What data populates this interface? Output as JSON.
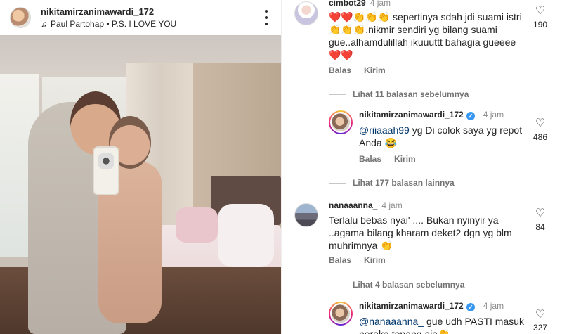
{
  "post": {
    "username": "nikitamirzanimawardi_172",
    "music": "Paul Partohap • P.S. I LOVE YOU"
  },
  "comments": [
    {
      "username": "cimbot29",
      "time": "4 jam",
      "text": "❤️❤️👏👏👏 sepertinya sdah jdi suami istri👏👏👏,nikmir sendiri yg bilang suami gue..alhamdulillah ikuuuttt bahagia gueeee ❤️❤️",
      "likes": "190",
      "reply": "Balas",
      "send": "Kirim"
    },
    {
      "view_replies": "Lihat 11 balasan sebelumnya"
    },
    {
      "username": "nikitamirzanimawardi_172",
      "time": "4 jam",
      "mention": "@riiaaah99",
      "text": " yg Di colok saya yg repot Anda 😂",
      "likes": "486",
      "reply": "Balas",
      "send": "Kirim"
    },
    {
      "view_replies": "Lihat 177 balasan lainnya"
    },
    {
      "username": "nanaaanna_",
      "time": "4 jam",
      "text": "Terlalu bebas nyai' .... Bukan nyinyir ya ..agama bilang kharam deket2 dgn yg blm muhrimnya 👏",
      "likes": "84",
      "reply": "Balas",
      "send": "Kirim"
    },
    {
      "view_replies": "Lihat 4 balasan sebelumnya"
    },
    {
      "username": "nikitamirzanimawardi_172",
      "time": "4 jam",
      "mention": "@nanaaanna_",
      "text": " gue udh PASTI masuk neraka tenang aja👏",
      "likes": "327"
    }
  ],
  "icons": {
    "heart": "♡",
    "music": "♫",
    "verified": "✓"
  }
}
